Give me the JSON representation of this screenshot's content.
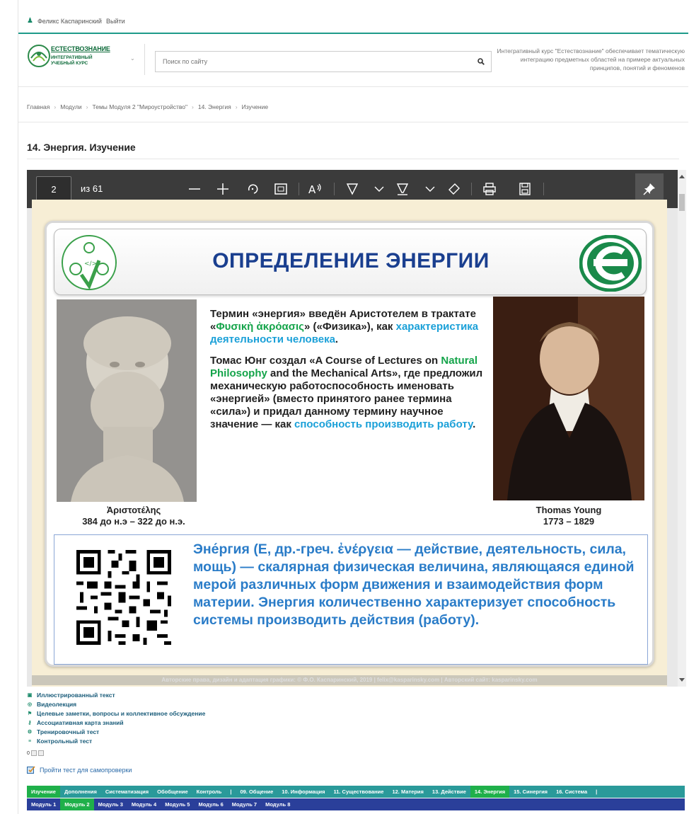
{
  "topbar": {
    "user_name": "Феликс Каспаринский",
    "logout": "Выйти"
  },
  "header": {
    "logo_title": "ЕСТЕСТВОЗНАНИЕ",
    "logo_sub1": "ИНТЕГРАТИВНЫЙ",
    "logo_sub2": "УЧЕБНЫЙ КУРС",
    "search_placeholder": "Поиск по сайту",
    "description": "Интегративный курс \"Естествознание\" обеспечивает тематическую интеграцию предметных областей на примере актуальных принципов, понятий и феноменов"
  },
  "breadcrumb": [
    "Главная",
    "Модули",
    "Темы Модуля 2 \"Мироустройство\"",
    "14. Энергия",
    "Изучение"
  ],
  "page_title": "14. Энергия. Изучение",
  "viewer": {
    "current_page": "2",
    "page_count": "из 61"
  },
  "slide": {
    "title": "ОПРЕДЕЛЕНИЕ ЭНЕРГИИ",
    "p1_a": "Термин «энергия» введён Аристотелем в трактате «",
    "p1_green": "Φυσικὴ ἀκρόασις",
    "p1_b": "» («Физика»), как ",
    "p1_blue": "характеристика деятельности человека",
    "p1_c": ".",
    "p2_a": "Томас Юнг создал «A Course of Lectures on ",
    "p2_green": "Natural Philosophy",
    "p2_b": " and the Mechanical Arts», где предложил механическую работоспособность именовать «энергией» (вместо принятого ранее термина «сила») и придал данному термину научное значение — как ",
    "p2_blue": "способность производить работу",
    "p2_c": ".",
    "cap_left_name": "Ἀριστοτέλης",
    "cap_left_dates": "384 до н.э – 322 до н.э.",
    "cap_right_name": "Thomas Young",
    "cap_right_dates": "1773 – 1829",
    "definition": "Эне́ргия (Е, др.-греч. ἐνέργεια — действие, деятельность, сила, мощь) — скалярная физическая величина, являющаяся единой мерой различных форм движения и взаимодействия форм материи. Энергия количественно характеризует способность системы производить действия (работу).",
    "copyright": "Авторские права, дизайн и адаптация графики: © Ф.О. Каспаринский, 2019 | felix@kasparinsky.com | Авторский сайт: kasparinsky.com"
  },
  "materials": [
    {
      "icon": "book-icon",
      "label": "Иллюстрированный текст"
    },
    {
      "icon": "video-icon",
      "label": "Видеолекция"
    },
    {
      "icon": "flag-icon",
      "label": "Целевые заметки, вопросы и коллективное обсуждение"
    },
    {
      "icon": "mindmap-icon",
      "label": "Ассоциативная карта знаний"
    },
    {
      "icon": "gear-icon",
      "label": "Тренировочный тест"
    },
    {
      "icon": "list-icon",
      "label": "Контрольный тест"
    }
  ],
  "mini_count": "0",
  "selftest_label": "Пройти тест для самопроверки",
  "nav1": [
    "Изучение",
    "Дополнения",
    "Систематизация",
    "Обобщение",
    "Контроль",
    "|",
    "09. Общение",
    "10. Информация",
    "11. Существование",
    "12. Материя",
    "13. Действие",
    "14. Энергия",
    "15. Синергия",
    "16. Система",
    "|"
  ],
  "nav2": [
    "Модуль 1",
    "Модуль 2",
    "Модуль 3",
    "Модуль 4",
    "Модуль 5",
    "Модуль 6",
    "Модуль 7",
    "Модуль 8"
  ],
  "colors": {
    "accent": "#1e9b8a",
    "active": "#1fb04a",
    "nav1_bg": "#2a9a9a",
    "nav2_bg": "#2a3f9a",
    "slide_title": "#1a3f8f"
  }
}
